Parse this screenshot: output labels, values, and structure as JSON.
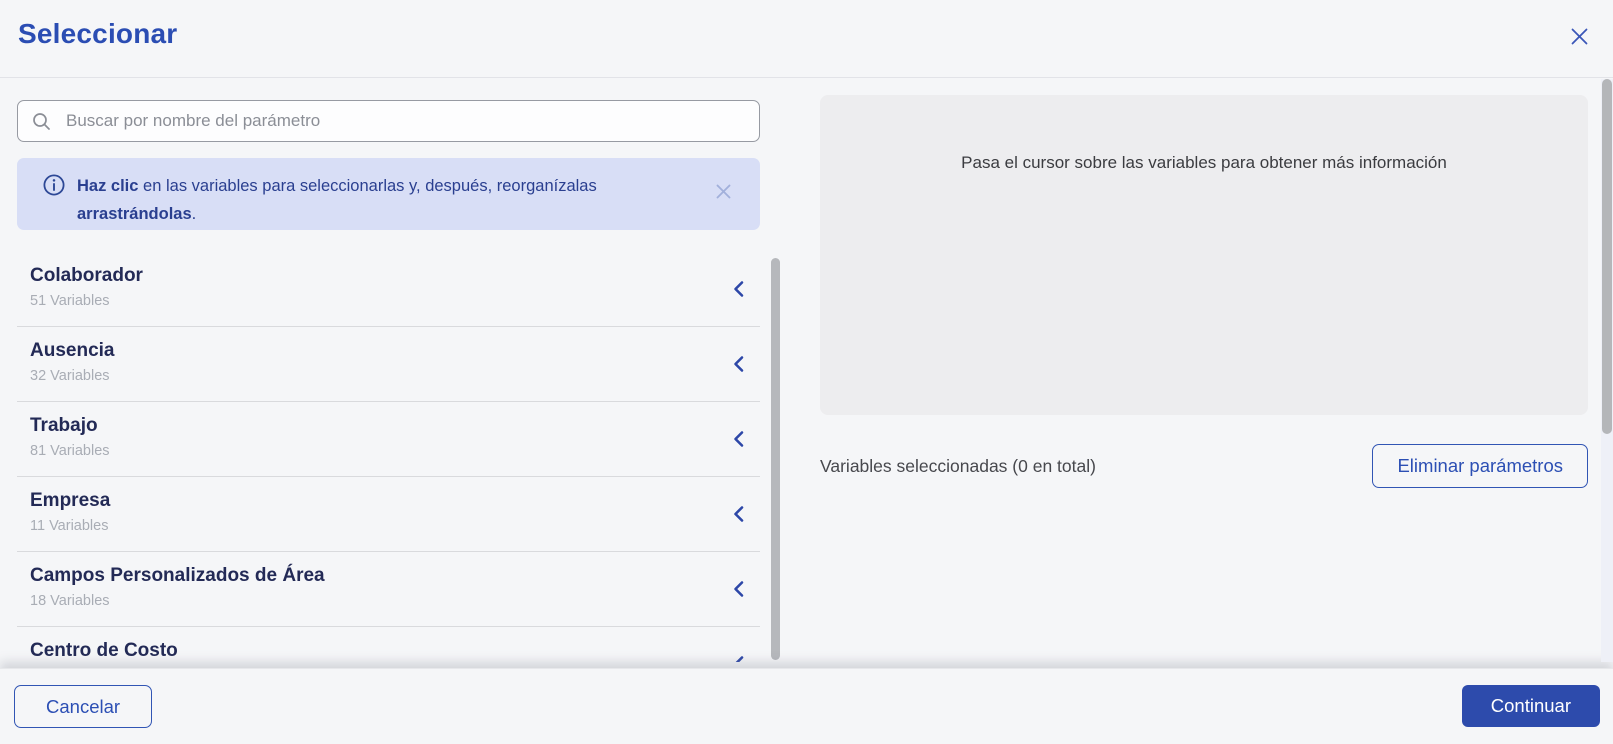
{
  "dialog": {
    "title": "Seleccionar"
  },
  "search": {
    "placeholder": "Buscar por nombre del parámetro"
  },
  "banner": {
    "bold_lead": "Haz clic",
    "line1_rest": " en las variables para seleccionarlas y, después, reorganízalas",
    "bold_line2": "arrastrándolas",
    "line2_suffix": "."
  },
  "categories": [
    {
      "label": "Colaborador",
      "count": "51 Variables"
    },
    {
      "label": "Ausencia",
      "count": "32 Variables"
    },
    {
      "label": "Trabajo",
      "count": "81 Variables"
    },
    {
      "label": "Empresa",
      "count": "11 Variables"
    },
    {
      "label": "Campos Personalizados de Área",
      "count": "18 Variables"
    },
    {
      "label": "Centro de Costo",
      "count": ""
    }
  ],
  "preview": {
    "hint": "Pasa el cursor sobre las variables para obtener más información"
  },
  "selection": {
    "summary": "Variables seleccionadas (0 en total)",
    "remove_button": "Eliminar parámetros"
  },
  "footer": {
    "cancel": "Cancelar",
    "continue": "Continuar"
  },
  "colors": {
    "accent": "#2b4db3",
    "continue_bg": "#2d4bac",
    "banner_bg": "#d8def6",
    "banner_text": "#2a3f90",
    "list_title": "#232a56",
    "muted_text": "#a9adb5",
    "panel_bg": "#ededef",
    "page_bg": "#f5f6f8"
  }
}
